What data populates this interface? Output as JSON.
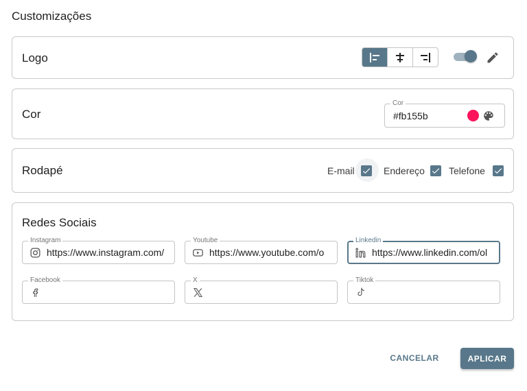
{
  "page": {
    "title": "Customizações"
  },
  "logo": {
    "title": "Logo",
    "alignment_options": [
      "align-left",
      "align-center",
      "align-right"
    ],
    "selected_alignment": "align-left",
    "visible_toggle_on": true
  },
  "color": {
    "title": "Cor",
    "field_label": "Cor",
    "value": "#fb155b",
    "swatch": "#fb155b"
  },
  "footer": {
    "title": "Rodapé",
    "options": [
      {
        "label": "E-mail",
        "checked": true
      },
      {
        "label": "Endereço",
        "checked": true
      },
      {
        "label": "Telefone",
        "checked": true
      }
    ]
  },
  "social": {
    "title": "Redes Sociais",
    "fields": [
      {
        "label": "Instagram",
        "value": "https://www.instagram.com/",
        "icon": "instagram-icon"
      },
      {
        "label": "Youtube",
        "value": "https://www.youtube.com/o",
        "icon": "youtube-icon"
      },
      {
        "label": "Linkedin",
        "value": "https://www.linkedin.com/ol",
        "icon": "linkedin-icon",
        "focused": true
      },
      {
        "label": "Facebook",
        "value": "",
        "icon": "facebook-icon"
      },
      {
        "label": "X",
        "value": "",
        "icon": "x-icon"
      },
      {
        "label": "Tiktok",
        "value": "",
        "icon": "tiktok-icon"
      }
    ]
  },
  "actions": {
    "cancel": "CANCELAR",
    "apply": "APLICAR"
  },
  "colors": {
    "accent": "#58778a",
    "border": "#c9c9c9",
    "toggle_track": "#9fb2bd"
  }
}
